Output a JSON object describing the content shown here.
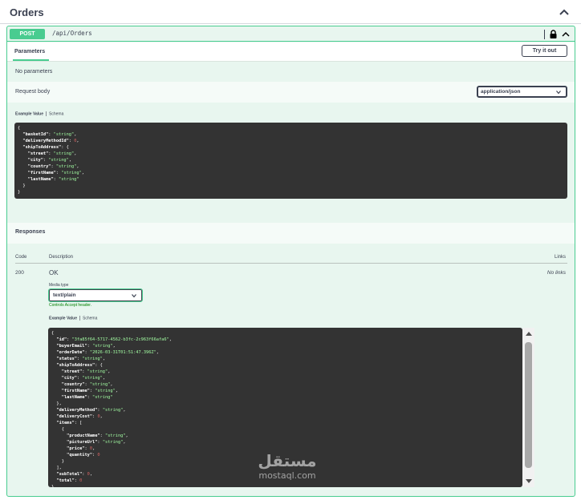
{
  "tag": {
    "title": "Orders"
  },
  "operation": {
    "method": "POST",
    "path": "/api/Orders"
  },
  "parameters": {
    "tab_label": "Parameters",
    "try_label": "Try it out",
    "empty_text": "No parameters"
  },
  "request_body": {
    "label": "Request body",
    "content_type": "application/json",
    "example_tab": "Example Value",
    "schema_tab": "Schema"
  },
  "responses": {
    "title": "Responses",
    "col_code": "Code",
    "col_description": "Description",
    "col_links": "Links",
    "items": [
      {
        "code": "200",
        "description": "OK",
        "links": "No links",
        "media_type_label": "Media type",
        "media_type": "text/plain",
        "accept_note": "Controls Accept header.",
        "example_tab": "Example Value",
        "schema_tab": "Schema"
      }
    ]
  },
  "watermark": {
    "arabic": "مستقل",
    "latin": "mostaql.com"
  },
  "colors": {
    "post_green": "#49cc90",
    "panel_bg": "#e8f6ef",
    "code_bg": "#333333",
    "string_green": "#a2fca2",
    "number_red": "#d36363"
  },
  "request_example": [
    {
      "indent": 0,
      "tokens": [
        {
          "t": "p",
          "v": "{"
        }
      ]
    },
    {
      "indent": 1,
      "tokens": [
        {
          "t": "k",
          "v": "\"basketId\""
        },
        {
          "t": "p",
          "v": ": "
        },
        {
          "t": "s",
          "v": "\"string\""
        },
        {
          "t": "p",
          "v": ","
        }
      ]
    },
    {
      "indent": 1,
      "tokens": [
        {
          "t": "k",
          "v": "\"deliveryMethodId\""
        },
        {
          "t": "p",
          "v": ": "
        },
        {
          "t": "n",
          "v": "0"
        },
        {
          "t": "p",
          "v": ","
        }
      ]
    },
    {
      "indent": 1,
      "tokens": [
        {
          "t": "k",
          "v": "\"shipToAddress\""
        },
        {
          "t": "p",
          "v": ": {"
        }
      ]
    },
    {
      "indent": 2,
      "tokens": [
        {
          "t": "k",
          "v": "\"street\""
        },
        {
          "t": "p",
          "v": ": "
        },
        {
          "t": "s",
          "v": "\"string\""
        },
        {
          "t": "p",
          "v": ","
        }
      ]
    },
    {
      "indent": 2,
      "tokens": [
        {
          "t": "k",
          "v": "\"city\""
        },
        {
          "t": "p",
          "v": ": "
        },
        {
          "t": "s",
          "v": "\"string\""
        },
        {
          "t": "p",
          "v": ","
        }
      ]
    },
    {
      "indent": 2,
      "tokens": [
        {
          "t": "k",
          "v": "\"country\""
        },
        {
          "t": "p",
          "v": ": "
        },
        {
          "t": "s",
          "v": "\"string\""
        },
        {
          "t": "p",
          "v": ","
        }
      ]
    },
    {
      "indent": 2,
      "tokens": [
        {
          "t": "k",
          "v": "\"firstName\""
        },
        {
          "t": "p",
          "v": ": "
        },
        {
          "t": "s",
          "v": "\"string\""
        },
        {
          "t": "p",
          "v": ","
        }
      ]
    },
    {
      "indent": 2,
      "tokens": [
        {
          "t": "k",
          "v": "\"lastName\""
        },
        {
          "t": "p",
          "v": ": "
        },
        {
          "t": "s",
          "v": "\"string\""
        }
      ]
    },
    {
      "indent": 1,
      "tokens": [
        {
          "t": "p",
          "v": "}"
        }
      ]
    },
    {
      "indent": 0,
      "tokens": [
        {
          "t": "p",
          "v": "}"
        }
      ]
    }
  ],
  "response_example": [
    {
      "indent": 0,
      "tokens": [
        {
          "t": "p",
          "v": "{"
        }
      ]
    },
    {
      "indent": 1,
      "tokens": [
        {
          "t": "k",
          "v": "\"id\""
        },
        {
          "t": "p",
          "v": ": "
        },
        {
          "t": "s",
          "v": "\"3fa85f64-5717-4562-b3fc-2c963f66afa6\""
        },
        {
          "t": "p",
          "v": ","
        }
      ]
    },
    {
      "indent": 1,
      "tokens": [
        {
          "t": "k",
          "v": "\"buyerEmail\""
        },
        {
          "t": "p",
          "v": ": "
        },
        {
          "t": "s",
          "v": "\"string\""
        },
        {
          "t": "p",
          "v": ","
        }
      ]
    },
    {
      "indent": 1,
      "tokens": [
        {
          "t": "k",
          "v": "\"orderDate\""
        },
        {
          "t": "p",
          "v": ": "
        },
        {
          "t": "s",
          "v": "\"2026-03-31T01:51:47.396Z\""
        },
        {
          "t": "p",
          "v": ","
        }
      ]
    },
    {
      "indent": 1,
      "tokens": [
        {
          "t": "k",
          "v": "\"status\""
        },
        {
          "t": "p",
          "v": ": "
        },
        {
          "t": "s",
          "v": "\"string\""
        },
        {
          "t": "p",
          "v": ","
        }
      ]
    },
    {
      "indent": 1,
      "tokens": [
        {
          "t": "k",
          "v": "\"shipToAddress\""
        },
        {
          "t": "p",
          "v": ": {"
        }
      ]
    },
    {
      "indent": 2,
      "tokens": [
        {
          "t": "k",
          "v": "\"street\""
        },
        {
          "t": "p",
          "v": ": "
        },
        {
          "t": "s",
          "v": "\"string\""
        },
        {
          "t": "p",
          "v": ","
        }
      ]
    },
    {
      "indent": 2,
      "tokens": [
        {
          "t": "k",
          "v": "\"city\""
        },
        {
          "t": "p",
          "v": ": "
        },
        {
          "t": "s",
          "v": "\"string\""
        },
        {
          "t": "p",
          "v": ","
        }
      ]
    },
    {
      "indent": 2,
      "tokens": [
        {
          "t": "k",
          "v": "\"country\""
        },
        {
          "t": "p",
          "v": ": "
        },
        {
          "t": "s",
          "v": "\"string\""
        },
        {
          "t": "p",
          "v": ","
        }
      ]
    },
    {
      "indent": 2,
      "tokens": [
        {
          "t": "k",
          "v": "\"firstName\""
        },
        {
          "t": "p",
          "v": ": "
        },
        {
          "t": "s",
          "v": "\"string\""
        },
        {
          "t": "p",
          "v": ","
        }
      ]
    },
    {
      "indent": 2,
      "tokens": [
        {
          "t": "k",
          "v": "\"lastName\""
        },
        {
          "t": "p",
          "v": ": "
        },
        {
          "t": "s",
          "v": "\"string\""
        }
      ]
    },
    {
      "indent": 1,
      "tokens": [
        {
          "t": "p",
          "v": "},"
        }
      ]
    },
    {
      "indent": 1,
      "tokens": [
        {
          "t": "k",
          "v": "\"deliveryMethod\""
        },
        {
          "t": "p",
          "v": ": "
        },
        {
          "t": "s",
          "v": "\"string\""
        },
        {
          "t": "p",
          "v": ","
        }
      ]
    },
    {
      "indent": 1,
      "tokens": [
        {
          "t": "k",
          "v": "\"deliveryCost\""
        },
        {
          "t": "p",
          "v": ": "
        },
        {
          "t": "n",
          "v": "0"
        },
        {
          "t": "p",
          "v": ","
        }
      ]
    },
    {
      "indent": 1,
      "tokens": [
        {
          "t": "k",
          "v": "\"items\""
        },
        {
          "t": "p",
          "v": ": ["
        }
      ]
    },
    {
      "indent": 2,
      "tokens": [
        {
          "t": "p",
          "v": "{"
        }
      ]
    },
    {
      "indent": 3,
      "tokens": [
        {
          "t": "k",
          "v": "\"productName\""
        },
        {
          "t": "p",
          "v": ": "
        },
        {
          "t": "s",
          "v": "\"string\""
        },
        {
          "t": "p",
          "v": ","
        }
      ]
    },
    {
      "indent": 3,
      "tokens": [
        {
          "t": "k",
          "v": "\"pictureUrl\""
        },
        {
          "t": "p",
          "v": ": "
        },
        {
          "t": "s",
          "v": "\"string\""
        },
        {
          "t": "p",
          "v": ","
        }
      ]
    },
    {
      "indent": 3,
      "tokens": [
        {
          "t": "k",
          "v": "\"price\""
        },
        {
          "t": "p",
          "v": ": "
        },
        {
          "t": "n",
          "v": "0"
        },
        {
          "t": "p",
          "v": ","
        }
      ]
    },
    {
      "indent": 3,
      "tokens": [
        {
          "t": "k",
          "v": "\"quantity\""
        },
        {
          "t": "p",
          "v": ": "
        },
        {
          "t": "n",
          "v": "0"
        }
      ]
    },
    {
      "indent": 2,
      "tokens": [
        {
          "t": "p",
          "v": "}"
        }
      ]
    },
    {
      "indent": 1,
      "tokens": [
        {
          "t": "p",
          "v": "],"
        }
      ]
    },
    {
      "indent": 1,
      "tokens": [
        {
          "t": "k",
          "v": "\"subTotal\""
        },
        {
          "t": "p",
          "v": ": "
        },
        {
          "t": "n",
          "v": "0"
        },
        {
          "t": "p",
          "v": ","
        }
      ]
    },
    {
      "indent": 1,
      "tokens": [
        {
          "t": "k",
          "v": "\"total\""
        },
        {
          "t": "p",
          "v": ": "
        },
        {
          "t": "n",
          "v": "0"
        }
      ]
    },
    {
      "indent": 0,
      "tokens": [
        {
          "t": "p",
          "v": "}"
        }
      ]
    }
  ]
}
